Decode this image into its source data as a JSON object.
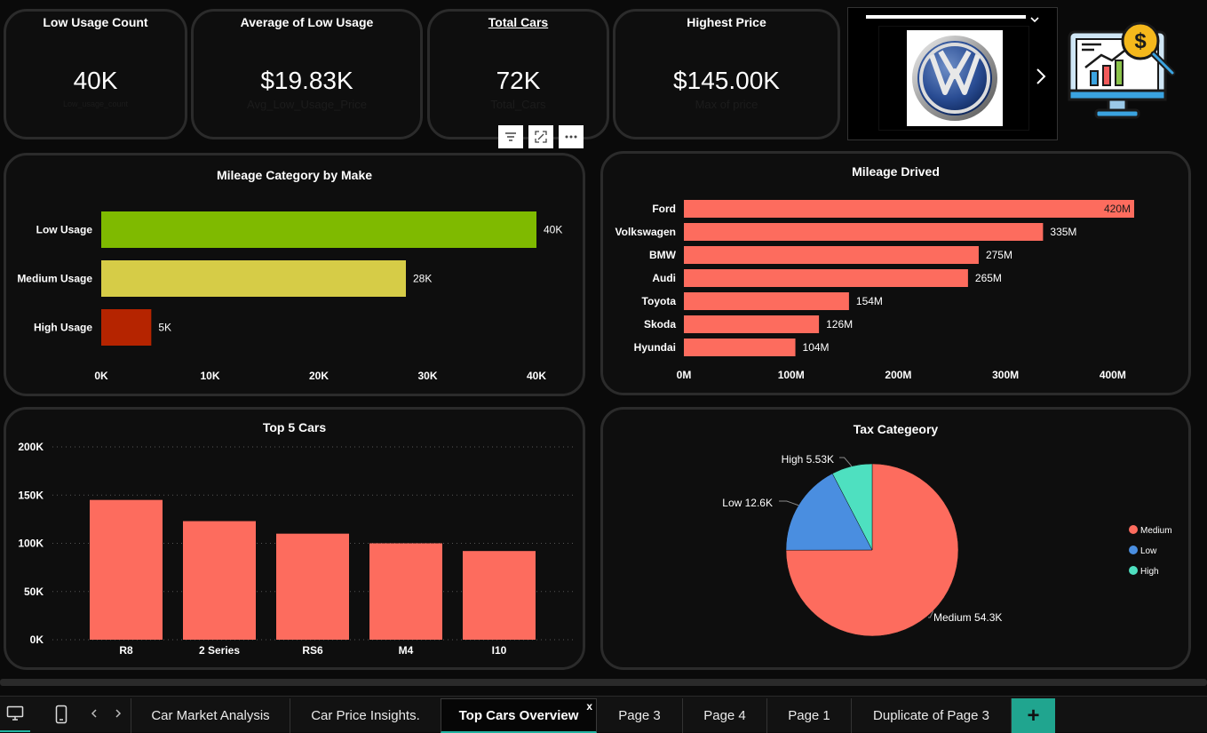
{
  "kpis": [
    {
      "title": "Low Usage Count",
      "value": "40K",
      "sub": "Low_usage_count"
    },
    {
      "title": "Average of Low Usage",
      "value": "$19.83K",
      "sub": "Avg_Low_Usage_Price"
    },
    {
      "title": "Total Cars",
      "value": "72K",
      "sub": "Total_Cars"
    },
    {
      "title": "Highest Price",
      "value": "$145.00K",
      "sub": "Max of price"
    }
  ],
  "visual_buttons": {
    "filter_icon": "filter-icon",
    "focus_icon": "focus-mode-icon",
    "more_icon": "more-options-icon"
  },
  "brand_slicer": {
    "logo": "volkswagen-logo",
    "dropdown_icon": "chevron-down-icon",
    "next_icon": "chevron-right-icon"
  },
  "dashboard_icon": "price-analytics-monitor-icon",
  "tabs": {
    "items": [
      "Car Market Analysis",
      "Car Price Insights.",
      "Top Cars Overview",
      "Page 3",
      "Page 4",
      "Page 1",
      "Duplicate of Page 3"
    ],
    "active_index": 2,
    "close_label": "x",
    "add_label": "+"
  },
  "colors": {
    "accent": "#20b2a0",
    "bar": "#fd6c5e",
    "low": "#7fba00",
    "medium": "#d6cc47",
    "high": "#b52400"
  },
  "chart_data": [
    {
      "type": "bar",
      "orientation": "horizontal",
      "title": "Mileage Category by Make",
      "categories": [
        "Low Usage",
        "Medium Usage",
        "High Usage"
      ],
      "values": [
        40000,
        28000,
        4600
      ],
      "data_labels": [
        "40K",
        "28K",
        "5K"
      ],
      "colors": [
        "#7fba00",
        "#d6cc47",
        "#b52400"
      ],
      "xlim": [
        0,
        40000
      ],
      "xticks": [
        0,
        10000,
        20000,
        30000,
        40000
      ],
      "xtick_labels": [
        "0K",
        "10K",
        "20K",
        "30K",
        "40K"
      ],
      "grid": false
    },
    {
      "type": "bar",
      "orientation": "horizontal",
      "title": "Mileage Drived",
      "categories": [
        "Ford",
        "Volkswagen",
        "BMW",
        "Audi",
        "Toyota",
        "Skoda",
        "Hyundai"
      ],
      "values": [
        420000000,
        335000000,
        275000000,
        265000000,
        154000000,
        126000000,
        104000000
      ],
      "data_labels": [
        "420M",
        "335M",
        "275M",
        "265M",
        "154M",
        "126M",
        "104M"
      ],
      "color": "#fd6c5e",
      "xlim": [
        0,
        420000000
      ],
      "xticks": [
        0,
        100000000,
        200000000,
        300000000,
        400000000
      ],
      "xtick_labels": [
        "0M",
        "100M",
        "200M",
        "300M",
        "400M"
      ],
      "grid": false
    },
    {
      "type": "bar",
      "orientation": "vertical",
      "title": "Top 5 Cars",
      "categories": [
        "R8",
        "2 Series",
        "RS6",
        "M4",
        "I10"
      ],
      "values": [
        145000,
        123000,
        110000,
        100000,
        92000
      ],
      "color": "#fd6c5e",
      "ylim": [
        0,
        200000
      ],
      "yticks": [
        0,
        50000,
        100000,
        150000,
        200000
      ],
      "ytick_labels": [
        "0K",
        "50K",
        "100K",
        "150K",
        "200K"
      ],
      "grid": true
    },
    {
      "type": "pie",
      "title": "Tax Categeory",
      "labels": [
        "Medium",
        "Low",
        "High"
      ],
      "values": [
        54300,
        12600,
        5530
      ],
      "slice_labels": [
        "Medium 54.3K",
        "Low 12.6K",
        "High 5.53K"
      ],
      "colors": [
        "#fd6c5e",
        "#4a8ee0",
        "#4ee0c0"
      ],
      "legend": "right"
    }
  ]
}
